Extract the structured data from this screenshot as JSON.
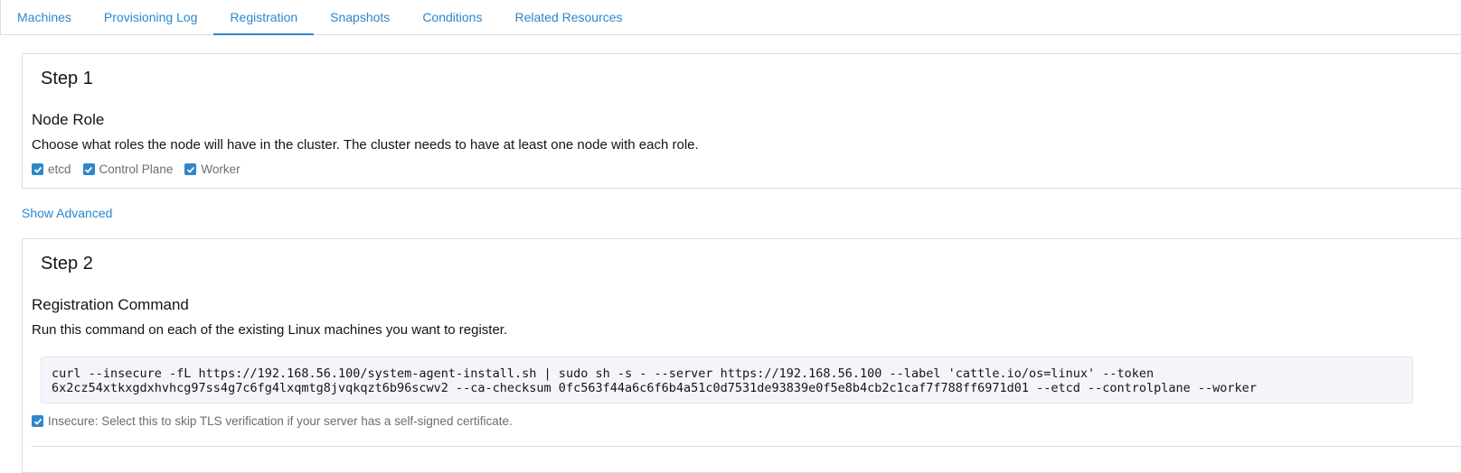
{
  "tabs": [
    {
      "label": "Machines",
      "active": false
    },
    {
      "label": "Provisioning Log",
      "active": false
    },
    {
      "label": "Registration",
      "active": true
    },
    {
      "label": "Snapshots",
      "active": false
    },
    {
      "label": "Conditions",
      "active": false
    },
    {
      "label": "Related Resources",
      "active": false
    }
  ],
  "step1": {
    "title": "Step 1",
    "section_title": "Node Role",
    "description": "Choose what roles the node will have in the cluster. The cluster needs to have at least one node with each role.",
    "roles": [
      {
        "label": "etcd",
        "checked": true
      },
      {
        "label": "Control Plane",
        "checked": true
      },
      {
        "label": "Worker",
        "checked": true
      }
    ]
  },
  "show_advanced": "Show Advanced",
  "step2": {
    "title": "Step 2",
    "section_title": "Registration Command",
    "description": "Run this command on each of the existing Linux machines you want to register.",
    "command_line1": "curl --insecure -fL https://192.168.56.100/system-agent-install.sh | sudo sh -s - --server https://192.168.56.100 --label 'cattle.io/os=linux' --token",
    "command_line2": "6x2cz54xtkxgdxhvhcg97ss4g7c6fg4lxqmtg8jvqkqzt6b96scwv2 --ca-checksum 0fc563f44a6c6f6b4a51c0d7531de93839e0f5e8b4cb2c1caf7f788ff6971d01 --etcd --controlplane --worker",
    "insecure_label": "Insecure: Select this to skip TLS verification if your server has a self-signed certificate.",
    "insecure_checked": true
  },
  "colors": {
    "accent": "#2f86c9",
    "border": "#dcdee7",
    "code_bg": "#f4f5fa"
  }
}
